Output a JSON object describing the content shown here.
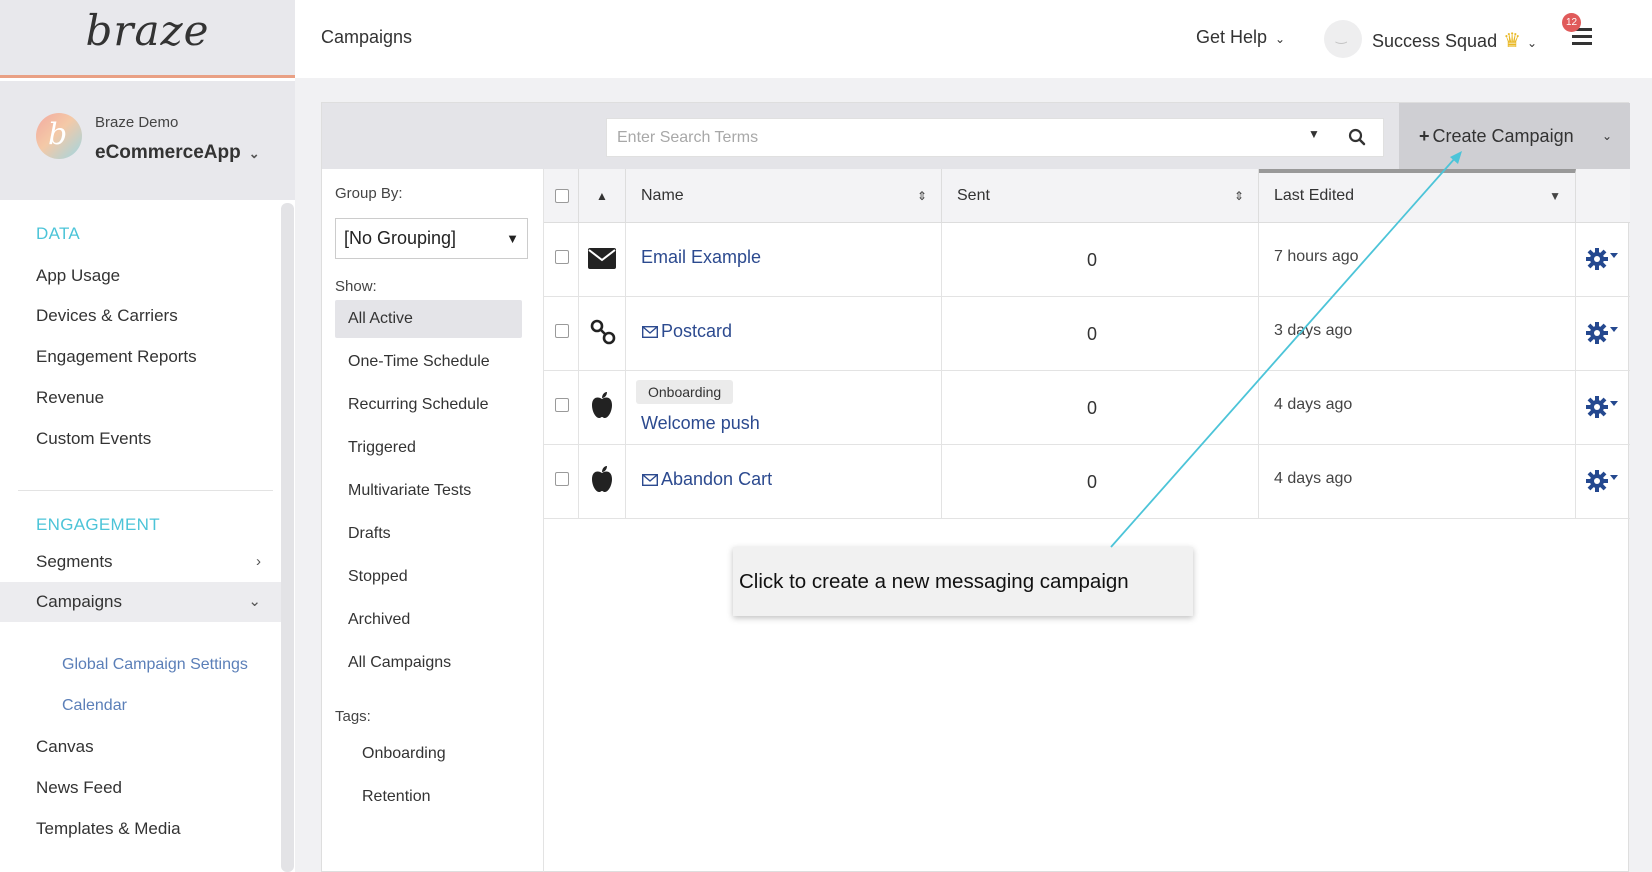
{
  "brand": {
    "logo_text": "braze",
    "accent": "#4cc4d8",
    "link_color": "#2c4a8f"
  },
  "app_selector": {
    "org": "Braze Demo",
    "app_name": "eCommerceApp",
    "avatar_letter": "b"
  },
  "sidebar": {
    "sections": [
      {
        "title": "DATA",
        "items": [
          "App Usage",
          "Devices & Carriers",
          "Engagement Reports",
          "Revenue",
          "Custom Events"
        ]
      },
      {
        "title": "ENGAGEMENT",
        "items": [
          "Segments",
          "Campaigns",
          "Global Campaign Settings",
          "Calendar",
          "Canvas",
          "News Feed",
          "Templates & Media"
        ]
      }
    ]
  },
  "header": {
    "page_title": "Campaigns",
    "help_label": "Get Help",
    "user_name": "Success Squad",
    "notification_count": "12"
  },
  "toolbar": {
    "search_placeholder": "Enter Search Terms",
    "create_label": "Create Campaign"
  },
  "filters": {
    "group_by_label": "Group By:",
    "group_by_value": "[No Grouping]",
    "show_label": "Show:",
    "show_items": [
      "All Active",
      "One-Time Schedule",
      "Recurring Schedule",
      "Triggered",
      "Multivariate Tests",
      "Drafts",
      "Stopped",
      "Archived",
      "All Campaigns"
    ],
    "selected_show": "All Active",
    "tags_label": "Tags:",
    "tags": [
      "Onboarding",
      "Retention"
    ]
  },
  "table": {
    "columns": [
      "Name",
      "Sent",
      "Last Edited"
    ],
    "sorted_column": "Last Edited",
    "rows": [
      {
        "channel_icon": "email-icon",
        "name": "Email Example",
        "tag": "",
        "sent": "0",
        "last_edited": "7 hours ago",
        "name_prefix_icon": ""
      },
      {
        "channel_icon": "webhook-icon",
        "name": "Postcard",
        "tag": "",
        "sent": "0",
        "last_edited": "3 days ago",
        "name_prefix_icon": "envelope-outline-icon"
      },
      {
        "channel_icon": "apple-icon",
        "name": "Welcome push",
        "tag": "Onboarding",
        "sent": "0",
        "last_edited": "4 days ago",
        "name_prefix_icon": ""
      },
      {
        "channel_icon": "apple-icon",
        "name": "Abandon Cart",
        "tag": "",
        "sent": "0",
        "last_edited": "4 days ago",
        "name_prefix_icon": "envelope-outline-icon"
      }
    ]
  },
  "callout": {
    "text": "Click to create a new messaging campaign"
  }
}
